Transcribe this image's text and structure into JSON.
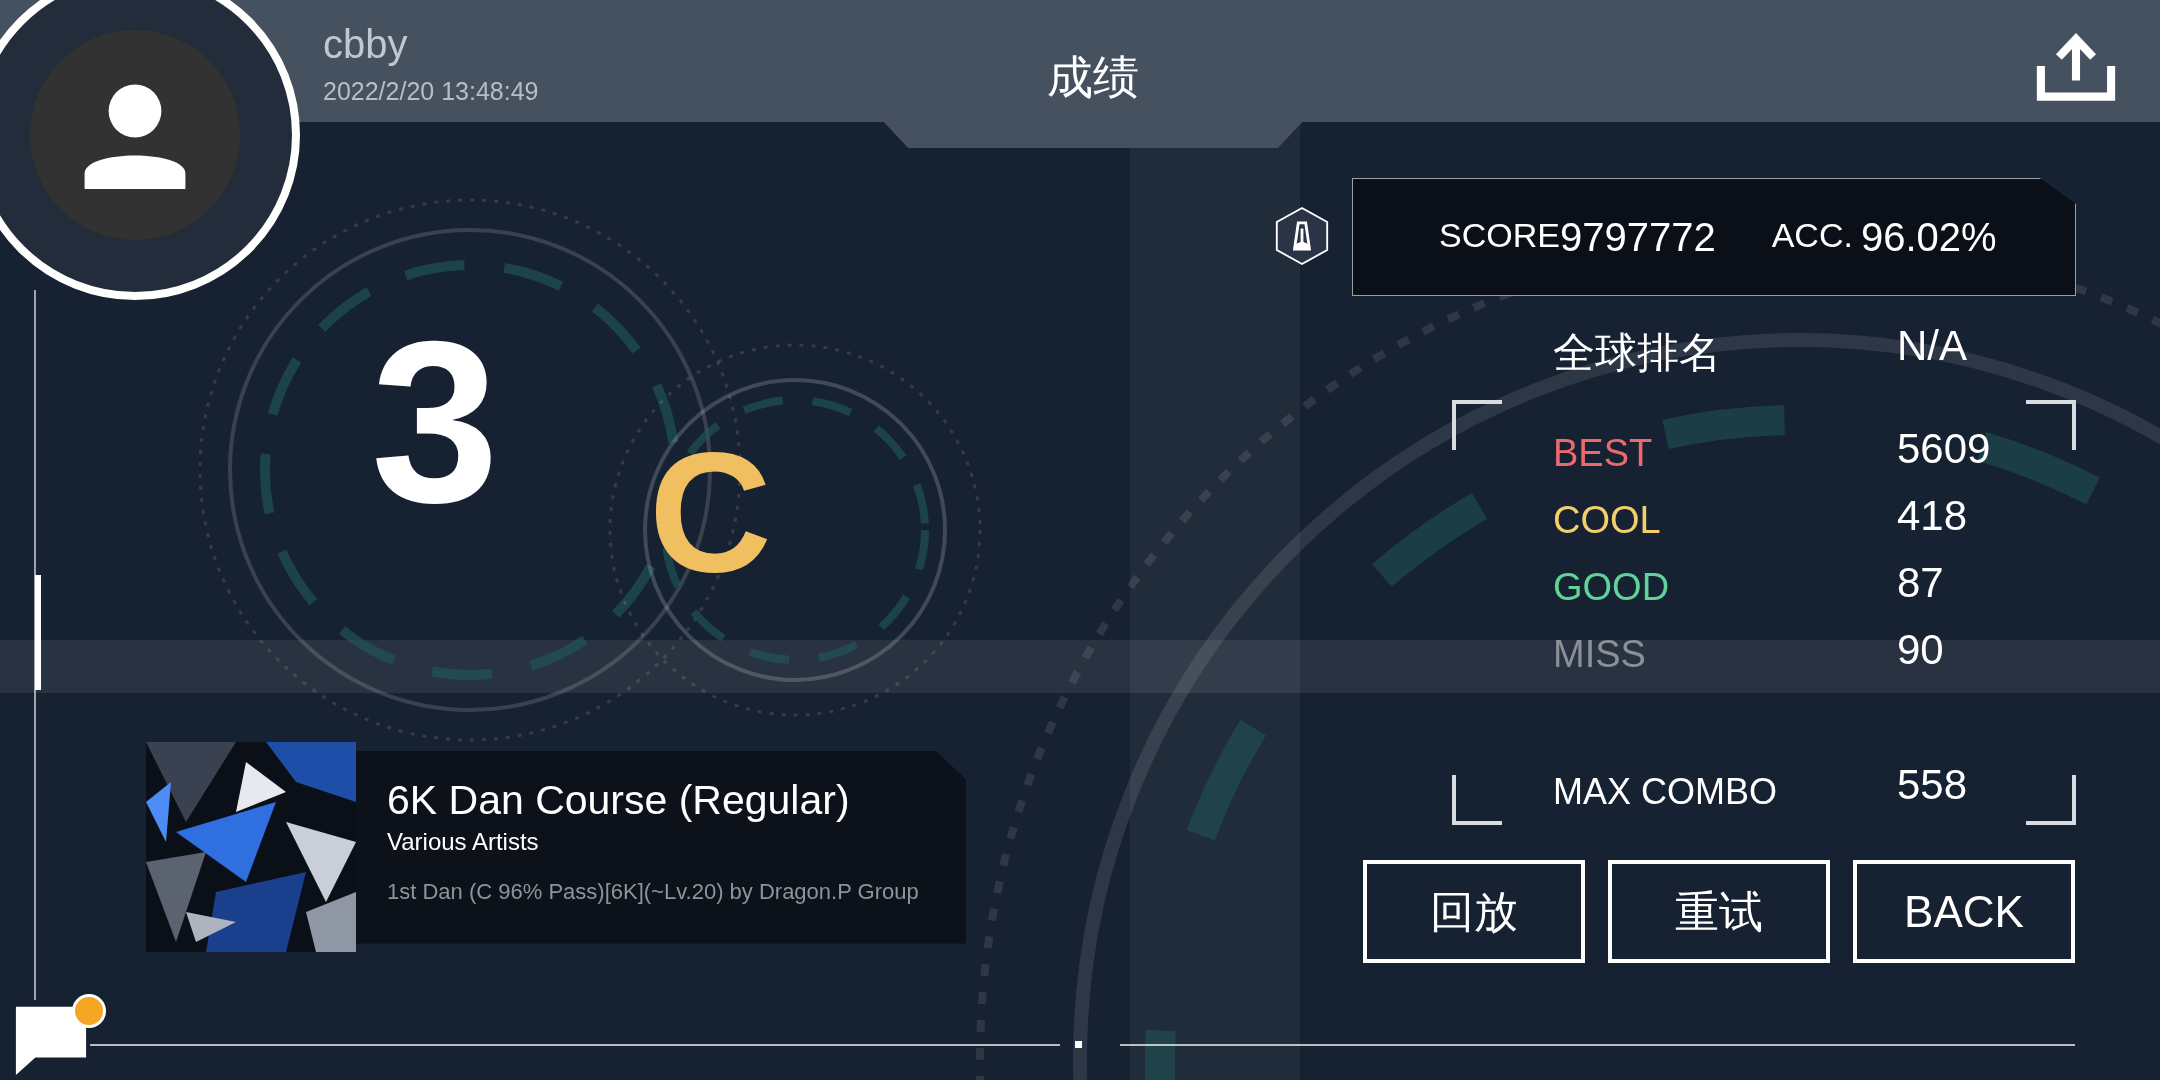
{
  "player": {
    "name": "cbby",
    "time": "2022/2/20 13:48:49"
  },
  "title": "成绩",
  "grade": {
    "number": "3",
    "letter": "C"
  },
  "score": {
    "label": "SCORE",
    "value": "9797772",
    "acc_label": "ACC.",
    "acc_value": "96.02%"
  },
  "rank": {
    "label": "全球排名",
    "value": "N/A"
  },
  "judgements": [
    {
      "label": "BEST",
      "value": "5609",
      "color": "#ec6a6e"
    },
    {
      "label": "COOL",
      "value": "418",
      "color": "#f2cf6a"
    },
    {
      "label": "GOOD",
      "value": "87",
      "color": "#5fd39a"
    },
    {
      "label": "MISS",
      "value": "90",
      "color": "#8b8f96"
    }
  ],
  "max_combo": {
    "label": "MAX COMBO",
    "value": "558"
  },
  "buttons": [
    "回放",
    "重试",
    "BACK"
  ],
  "song": {
    "title": "6K Dan Course (Regular)",
    "artist": "Various Artists",
    "description": "1st Dan (C 96% Pass)[6K](~Lv.20) by Dragon.P Group"
  },
  "chat": {
    "unread": true
  }
}
